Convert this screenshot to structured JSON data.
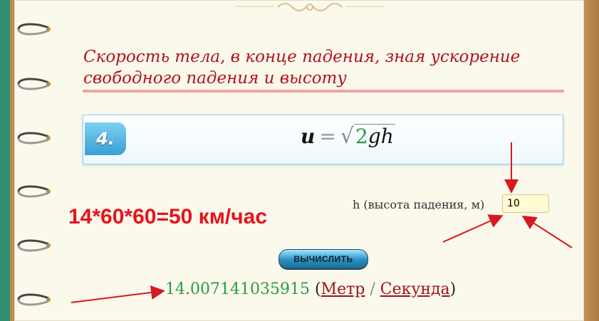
{
  "title": "Скорость тела, в конце падения, зная ускорение свободного падения и высоту",
  "formula": {
    "number": "4.",
    "lhs": "u",
    "eq": "=",
    "coef": "2",
    "vars": "gh"
  },
  "input": {
    "label": "h (высота падения, м)",
    "value": "10"
  },
  "annotation": "14*60*60=50 км/час",
  "button": {
    "label": "ВЫЧИСЛИТЬ"
  },
  "result": {
    "value": "14.007141035915",
    "open": "(",
    "unit_distance": "Метр",
    "slash": "/",
    "unit_time": "Секунда",
    "close": ")"
  },
  "colors": {
    "title": "#b1121b",
    "result_value": "#2a9a4a",
    "annotation": "#e5141d",
    "arrows": "#d51a1f"
  }
}
